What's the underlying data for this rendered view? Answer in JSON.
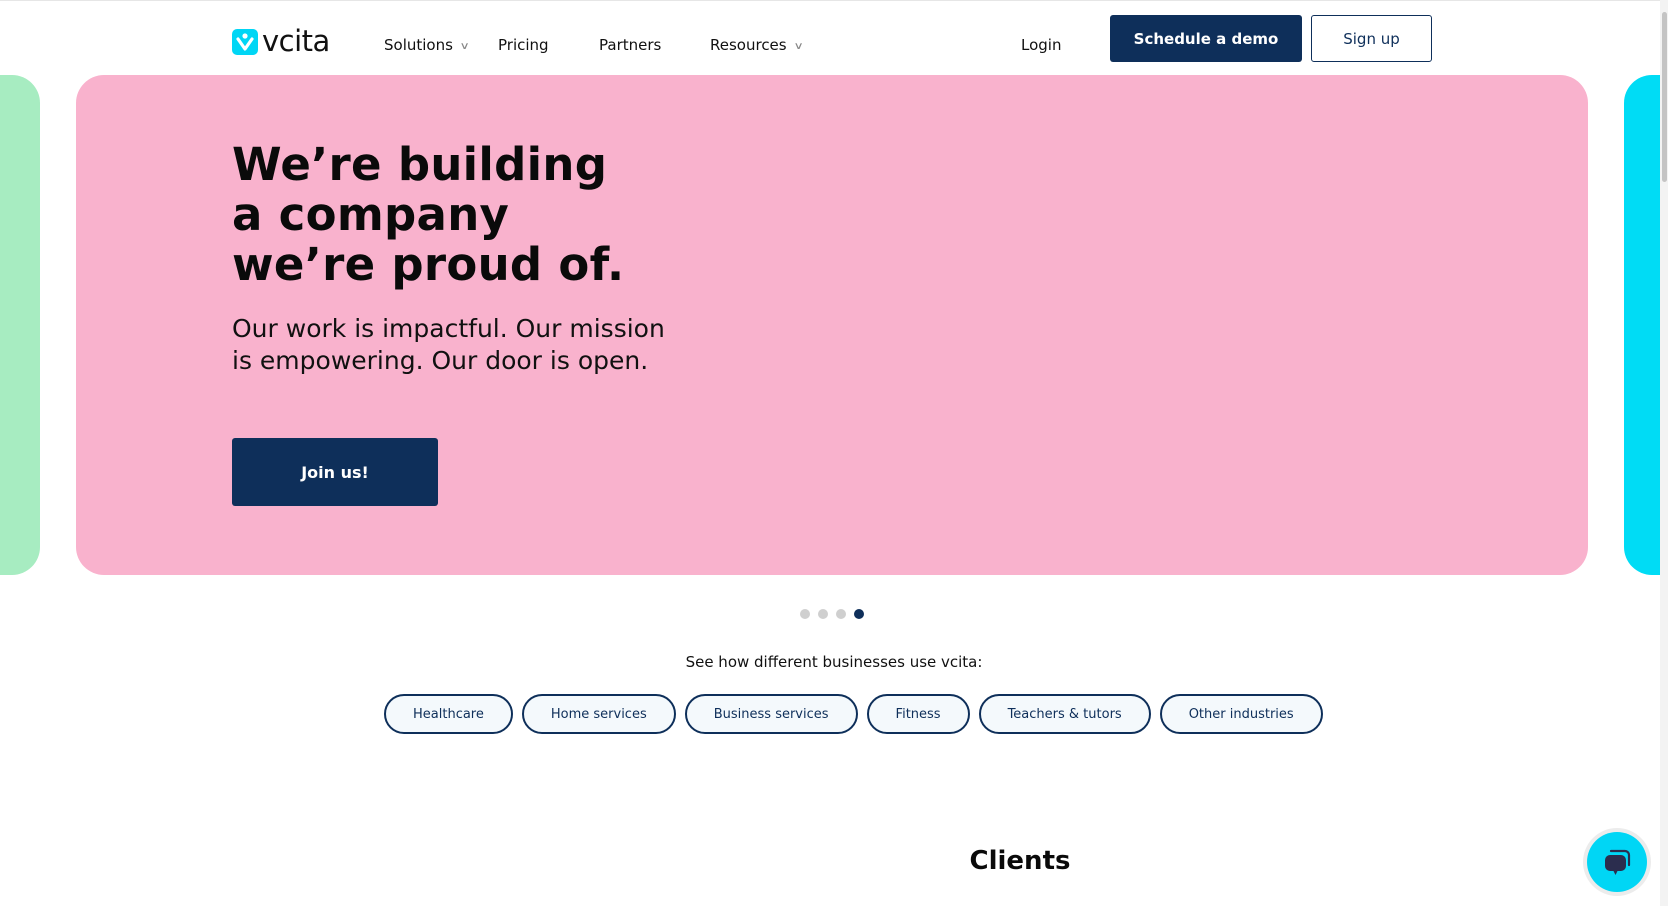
{
  "brand": {
    "name": "vcita",
    "accent": "#00d6f5",
    "navy": "#0e2f5a"
  },
  "nav": {
    "items": [
      {
        "label": "Solutions",
        "has_dropdown": true
      },
      {
        "label": "Pricing",
        "has_dropdown": false
      },
      {
        "label": "Partners",
        "has_dropdown": false
      },
      {
        "label": "Resources",
        "has_dropdown": true
      }
    ],
    "login": "Login",
    "schedule_demo": "Schedule a demo",
    "sign_up": "Sign up"
  },
  "hero": {
    "title_lines": [
      "We’re building",
      "a company",
      "we’re proud of."
    ],
    "subtitle_lines": [
      "Our work is impactful. Our mission",
      "is empowering. Our door is open."
    ],
    "cta": "Join us!",
    "card_colors": {
      "previous": "#a7ecc1",
      "current": "#f9b2cd",
      "next": "#00dcf5"
    }
  },
  "carousel": {
    "total_slides": 4,
    "active_slide": 4
  },
  "industries": {
    "label": "See how different businesses use vcita:",
    "options": [
      "Healthcare",
      "Home services",
      "Business services",
      "Fitness",
      "Teachers & tutors",
      "Other industries"
    ]
  },
  "clients": {
    "heading": "Clients"
  },
  "chat": {
    "icon": "chat-bubbles-icon"
  }
}
